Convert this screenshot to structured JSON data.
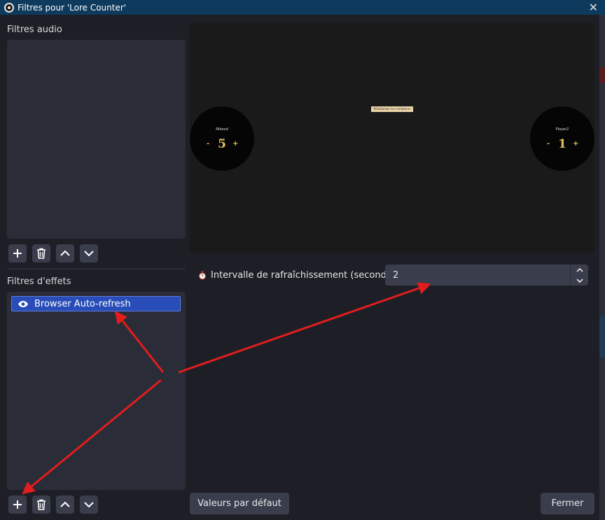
{
  "window": {
    "title": "Filtres pour 'Lore Counter'"
  },
  "audio_filters": {
    "heading": "Filtres audio"
  },
  "effect_filters": {
    "heading": "Filtres d'effets",
    "items": [
      {
        "label": "Browser Auto-refresh",
        "visible": true,
        "selected": true
      }
    ]
  },
  "preview": {
    "reset_label": "Réinitialiser les compteurs",
    "players": [
      {
        "name": "Nibood",
        "value": "5",
        "minus": "-",
        "plus": "+"
      },
      {
        "name": "Player2",
        "value": "1",
        "minus": "-",
        "plus": "+"
      }
    ]
  },
  "properties": {
    "refresh_interval": {
      "label": "Intervalle de rafraîchissement (secondes)",
      "value": "2"
    }
  },
  "footer": {
    "defaults_button": "Valeurs par défaut",
    "close_button": "Fermer"
  },
  "icons": {
    "add": "plus-icon",
    "remove": "trash-icon",
    "up": "chevron-up-icon",
    "down": "chevron-down-icon",
    "visibility": "eye-icon",
    "property": "stopwatch-icon"
  },
  "colors": {
    "window_bg": "#1e1f26",
    "titlebar": "#0e3a5e",
    "panel": "#2a2c37",
    "button": "#3a3d4b",
    "selection": "#284cb8",
    "annotation_arrow": "#e11d1d",
    "counter_text": "#e2c15a"
  }
}
